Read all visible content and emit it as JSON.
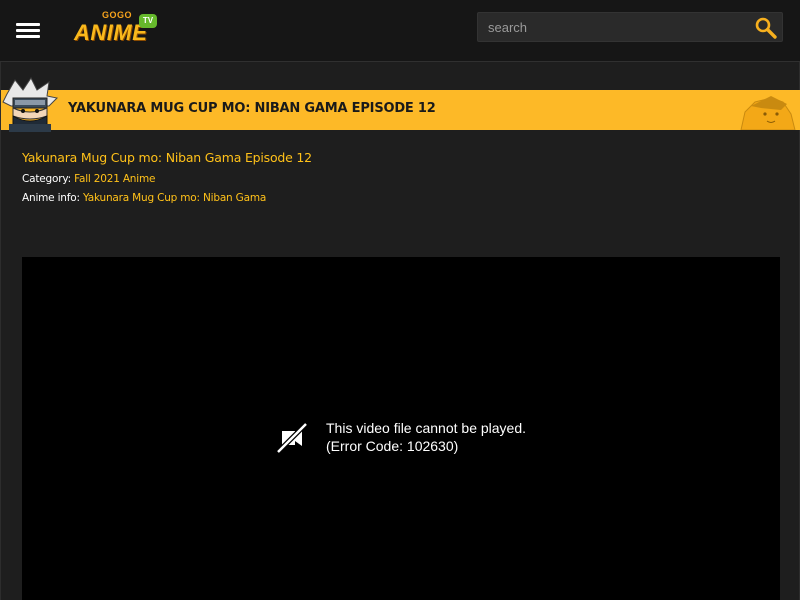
{
  "header": {
    "logo": {
      "top_text": "GOGO",
      "main_text": "ANIME",
      "badge_text": "TV"
    },
    "search": {
      "placeholder": "search"
    }
  },
  "page": {
    "banner_title": "YAKUNARA MUG CUP MO: NIBAN GAMA EPISODE 12",
    "episode_title": "Yakunara Mug Cup mo: Niban Gama Episode 12",
    "category": {
      "label": "Category:",
      "value": "Fall 2021 Anime"
    },
    "anime_info": {
      "label": "Anime info:",
      "value": "Yakunara Mug Cup mo: Niban Gama"
    }
  },
  "player": {
    "error_line1": "This video file cannot be played.",
    "error_line2": "(Error Code: 102630)"
  },
  "colors": {
    "accent": "#ffc119",
    "banner": "#fdb927",
    "background": "#1e1e1e",
    "header": "#161616",
    "player": "#000000"
  },
  "icons": [
    "menu-icon",
    "search-icon",
    "video-error-icon"
  ]
}
